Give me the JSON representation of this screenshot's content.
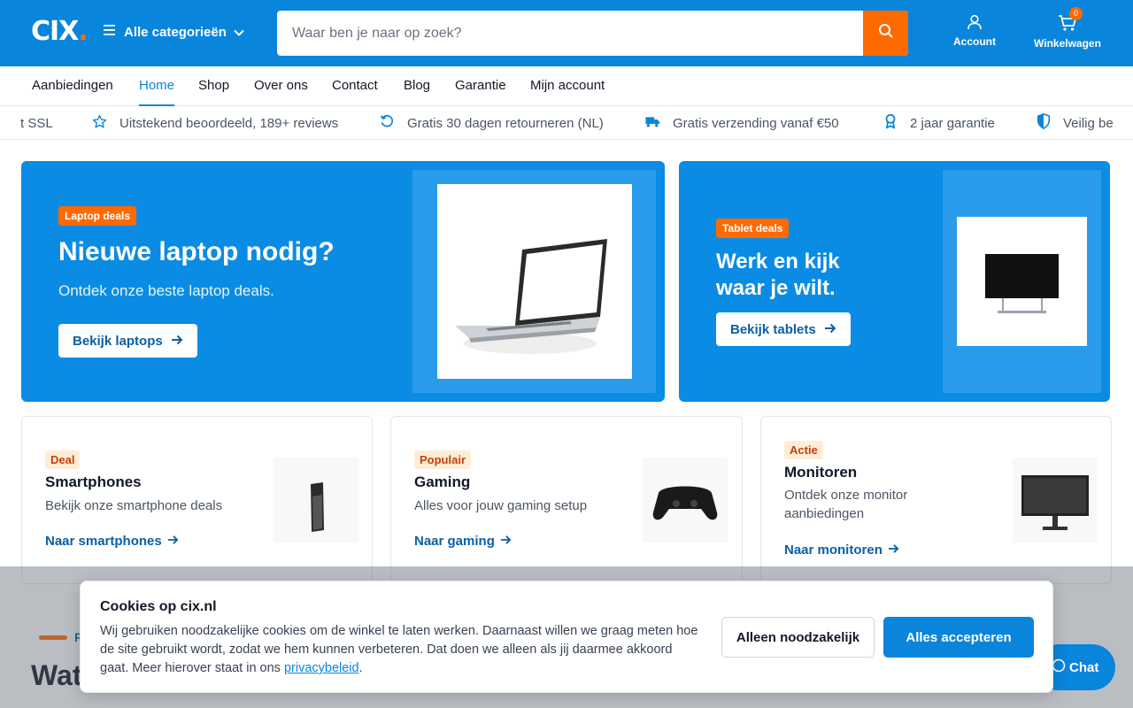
{
  "header": {
    "logo_text": "CIX",
    "logo_dot": ".",
    "categories_label": "Alle categorieën",
    "search_placeholder": "Waar ben je naar op zoek?",
    "account_label": "Account",
    "cart_label": "Winkelwagen",
    "cart_count": "0"
  },
  "nav": {
    "items": [
      "Aanbiedingen",
      "Home",
      "Shop",
      "Over ons",
      "Contact",
      "Blog",
      "Garantie",
      "Mijn account"
    ],
    "active": "Home"
  },
  "usp": {
    "items": [
      "t SSL",
      "Uitstekend beoordeeld, 189+ reviews",
      "Gratis 30 dagen retourneren (NL)",
      "Gratis verzending vanaf €50",
      "2 jaar garantie",
      "Veilig be"
    ]
  },
  "hero_laptop": {
    "badge": "Laptop deals",
    "title": "Nieuwe laptop nodig?",
    "subtitle": "Ontdek onze beste laptop deals.",
    "button": "Bekijk laptops"
  },
  "hero_tablet": {
    "badge": "Tablet deals",
    "title_line1": "Werk en kijk",
    "title_line2": "waar je wilt.",
    "button": "Bekijk tablets"
  },
  "categories": [
    {
      "badge": "Deal",
      "title": "Smartphones",
      "desc": "Bekijk onze smartphone deals",
      "link": "Naar smartphones"
    },
    {
      "badge": "Populair",
      "title": "Gaming",
      "desc": "Alles voor jouw gaming setup",
      "link": "Naar gaming"
    },
    {
      "badge": "Actie",
      "title": "Monitoren",
      "desc": "Ontdek onze monitor aanbiedingen",
      "link": "Naar monitoren"
    }
  ],
  "section": {
    "eyebrow": "R",
    "title": "Wat"
  },
  "cookie": {
    "title": "Cookies op cix.nl",
    "text": "Wij gebruiken noodzakelijke cookies om de winkel te laten werken. Daarnaast willen we graag meten hoe de site gebruikt wordt, zodat we hem kunnen verbeteren. Dat doen we alleen als jij daarmee akkoord gaat. Meer hierover staat in ons ",
    "link": "privacybeleid",
    "text_end": ".",
    "btn_necessary": "Alleen noodzakelijk",
    "btn_accept": "Alles accepteren"
  },
  "chat": {
    "label": "Chat"
  },
  "colors": {
    "brand_blue": "#0a85dc",
    "accent_orange": "#ff6a00"
  }
}
